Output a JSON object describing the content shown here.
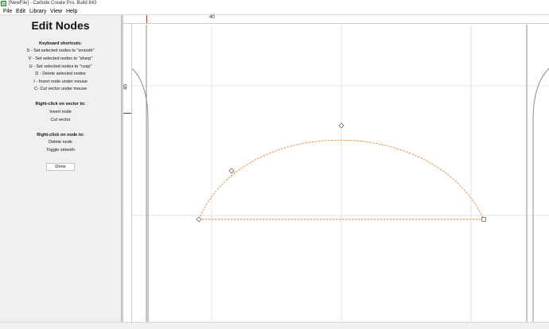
{
  "window": {
    "title": "[NewFile] - Carbide Create Pro. Build 843"
  },
  "menu": {
    "items": [
      "File",
      "Edit",
      "Library",
      "View",
      "Help"
    ]
  },
  "panel": {
    "title": "Edit Nodes",
    "keyboard_heading": "Keyboard shortcuts:",
    "shortcuts": [
      "S - Set selected nodes to \"smooth\"",
      "V - Set selected nodes to \"sharp\"",
      "U - Set selected nodes to \"cusp\"",
      "D - Delete selected nodes",
      "I - Insert node under mouse",
      "C- Cut vector under mouse"
    ],
    "vector_heading": "Right-click on vector to:",
    "vector_actions": [
      "Insert node",
      "Cut vector"
    ],
    "node_heading": "Right-click on node to:",
    "node_actions": [
      "Delete node",
      "Toggle smooth"
    ],
    "done_label": "Done"
  },
  "rulers": {
    "top_label": "40",
    "left_label": "40"
  },
  "colors": {
    "vector": "#f07f2a",
    "marker": "#e02020",
    "grid": "#dcdcdc"
  }
}
